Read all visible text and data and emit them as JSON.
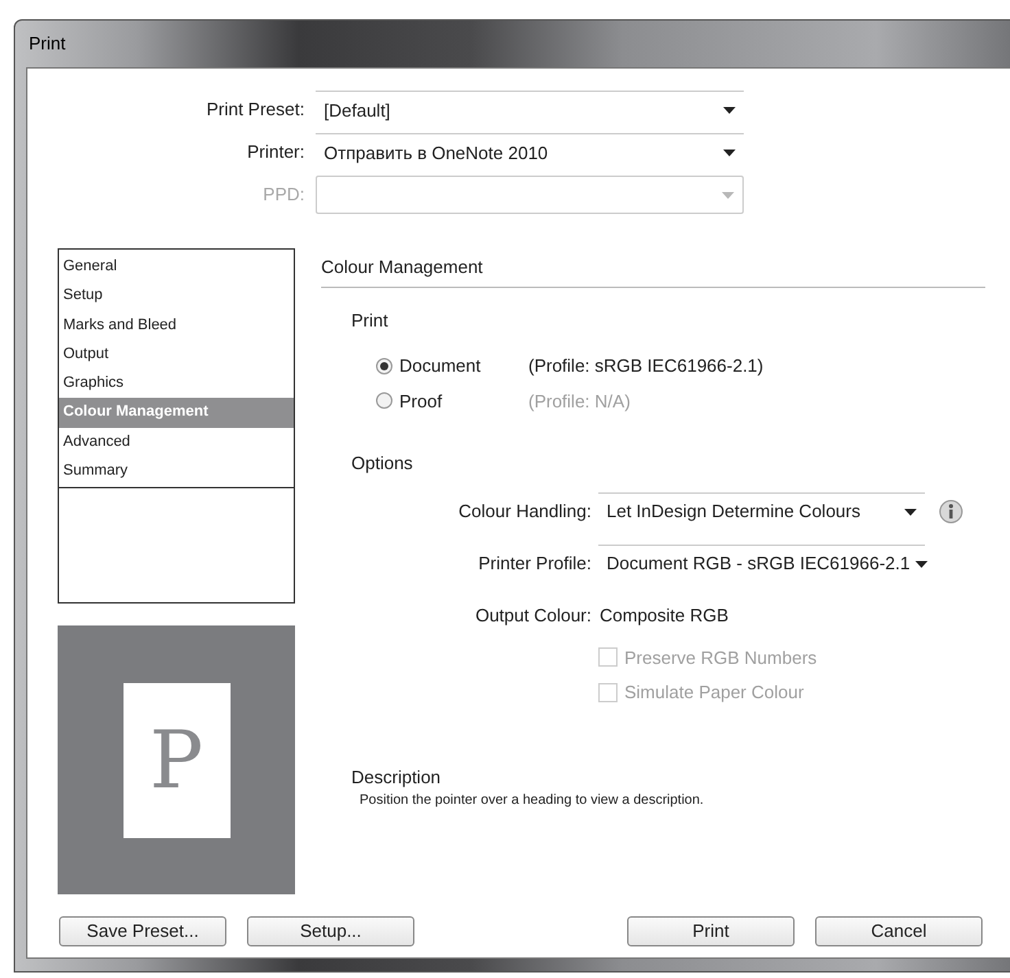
{
  "window": {
    "title": "Print"
  },
  "top_fields": [
    {
      "label": "Print Preset:",
      "value": "[Default]",
      "disabled": false
    },
    {
      "label": "Printer:",
      "value": "Отправить в OneNote 2010",
      "disabled": false
    },
    {
      "label": "PPD:",
      "disabled": true
    }
  ],
  "sidebar": {
    "items": [
      {
        "label": "General",
        "selected": false
      },
      {
        "label": "Setup",
        "selected": false
      },
      {
        "label": "Marks and Bleed",
        "selected": false
      },
      {
        "label": "Output",
        "selected": false
      },
      {
        "label": "Graphics",
        "selected": false
      },
      {
        "label": "Colour Management",
        "selected": true
      },
      {
        "label": "Advanced",
        "selected": false
      },
      {
        "label": "Summary",
        "selected": false
      }
    ]
  },
  "panel": {
    "title": "Colour Management",
    "print": {
      "heading": "Print",
      "options": [
        {
          "label": "Document",
          "profile": "(Profile: sRGB IEC61966-2.1)",
          "selected": true
        },
        {
          "label": "Proof",
          "profile": "(Profile: N/A)",
          "selected": false
        }
      ]
    },
    "options": {
      "heading": "Options",
      "colour_handling": {
        "label": "Colour Handling:",
        "value": "Let InDesign Determine Colours"
      },
      "printer_profile": {
        "label": "Printer Profile:",
        "value": "Document RGB - sRGB IEC61966-2.1"
      },
      "output_colour": {
        "label": "Output Colour:",
        "value": "Composite RGB"
      },
      "checkboxes": [
        {
          "label": "Preserve RGB Numbers",
          "checked": false,
          "disabled": true
        },
        {
          "label": "Simulate Paper Colour",
          "checked": false,
          "disabled": true
        }
      ]
    },
    "description": {
      "heading": "Description",
      "text": "Position the pointer over a heading to view a description."
    }
  },
  "preview": {
    "letter": "P"
  },
  "buttons": [
    {
      "label": "Save Preset..."
    },
    {
      "label": "Setup..."
    },
    {
      "label": "Print"
    },
    {
      "label": "Cancel"
    }
  ]
}
